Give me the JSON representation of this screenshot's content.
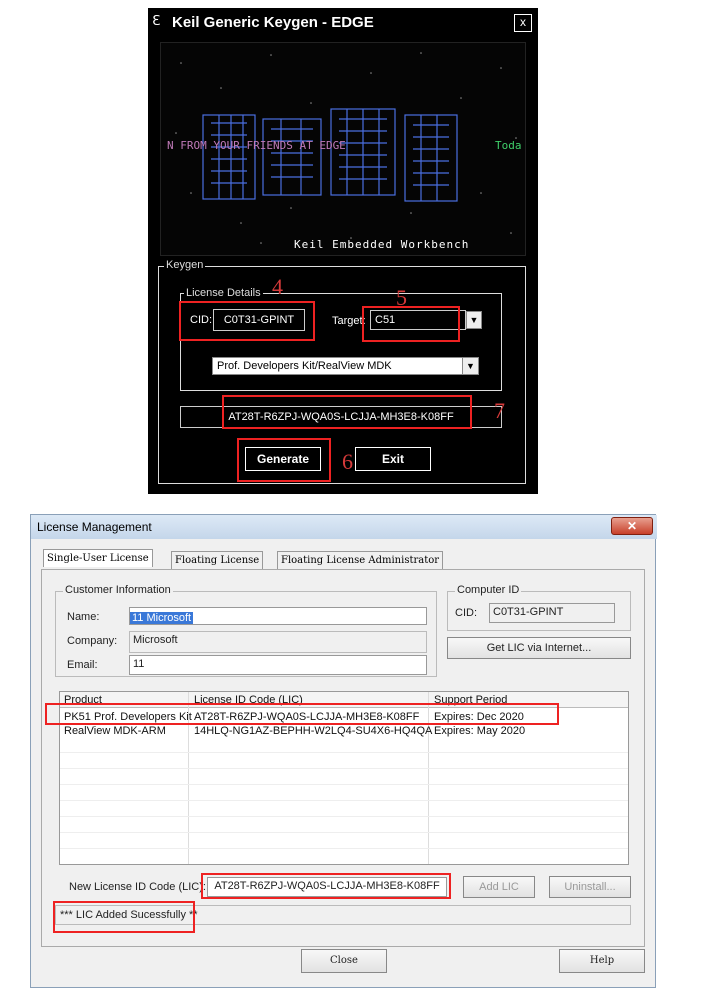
{
  "keygen": {
    "title": "Keil Generic Keygen - EDGE",
    "close_glyph": "x",
    "banner_text": "N FROM YOUR FRIENDS AT EDGE",
    "banner_side_text": "Toda",
    "banner_footer": "Keil Embedded Workbench",
    "group_label": "Keygen",
    "details_label": "License Details",
    "cid_label": "CID:",
    "cid_value": "C0T31-GPINT",
    "target_label": "Target:",
    "target_value": "C51",
    "product_value": "Prof. Developers Kit/RealView MDK",
    "key_value": "AT28T-R6ZPJ-WQA0S-LCJJA-MH3E8-K08FF",
    "generate_label": "Generate",
    "exit_label": "Exit"
  },
  "annotations": {
    "n4": "4",
    "n5": "5",
    "n6": "6",
    "n7": "7"
  },
  "license": {
    "title": "License Management",
    "tabs": [
      "Single-User License",
      "Floating License",
      "Floating License Administrator"
    ],
    "customer_group": "Customer Information",
    "name_label": "Name:",
    "name_value": "11 Microsoft",
    "company_label": "Company:",
    "company_value": "Microsoft",
    "email_label": "Email:",
    "email_value": "11",
    "computer_group": "Computer ID",
    "cid_label": "CID:",
    "cid_value": "C0T31-GPINT",
    "get_lic_label": "Get LIC via Internet...",
    "columns": [
      "Product",
      "License ID Code (LIC)",
      "Support Period"
    ],
    "rows": [
      [
        "PK51 Prof. Developers Kit",
        "AT28T-R6ZPJ-WQA0S-LCJJA-MH3E8-K08FF",
        "Expires: Dec 2020"
      ],
      [
        "RealView MDK-ARM",
        "14HLQ-NG1AZ-BEPHH-W2LQ4-SU4X6-HQ4QA",
        "Expires: May 2020"
      ]
    ],
    "new_lic_label": "New License ID Code (LIC):",
    "new_lic_value": "AT28T-R6ZPJ-WQA0S-LCJJA-MH3E8-K08FF",
    "add_lic_label": "Add LIC",
    "uninstall_label": "Uninstall...",
    "status_text": "*** LIC Added Sucessfully **",
    "close_label": "Close",
    "help_label": "Help"
  },
  "colors": {
    "annotation_red": "#e22222",
    "banner_blue": "#3b5fd0"
  }
}
